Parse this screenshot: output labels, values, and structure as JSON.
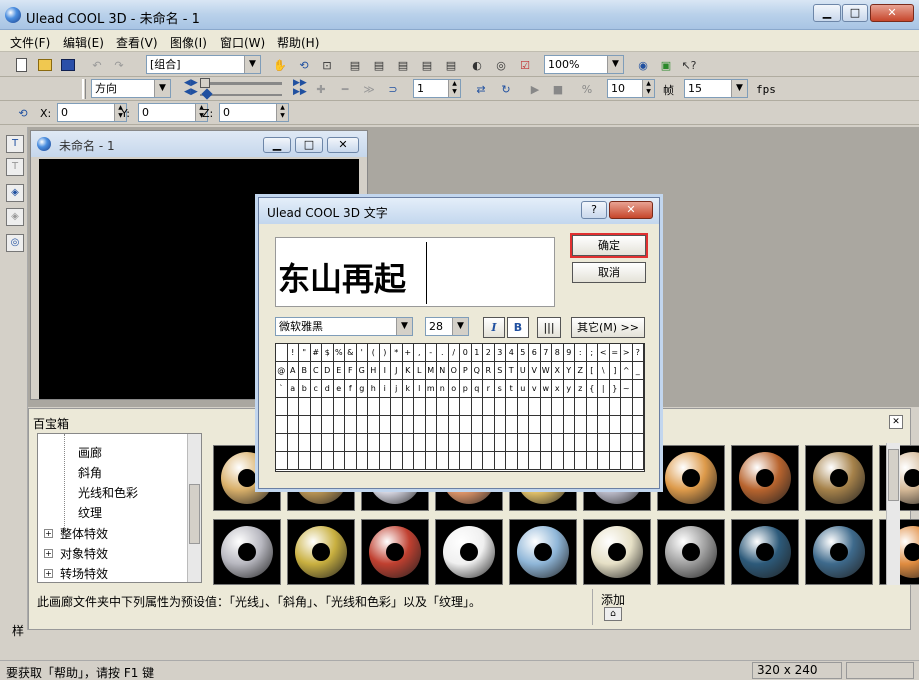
{
  "window": {
    "title": "Ulead COOL 3D - 未命名 - 1",
    "min": "▁",
    "max": "□",
    "close": "✕"
  },
  "menu": [
    "文件(F)",
    "编辑(E)",
    "查看(V)",
    "图像(I)",
    "窗口(W)",
    "帮助(H)"
  ],
  "toolbar1": {
    "group_combo": "[组合]",
    "zoom_combo": "100%"
  },
  "toolbar2": {
    "direction_combo": "方向",
    "frame_value": "1",
    "fps_value_a": "10",
    "frame_label": "帧",
    "fps_value_b": "15",
    "fps_label": "fps"
  },
  "toolbar3": {
    "x_label": "X:",
    "x_value": "0",
    "y_label": "Y:",
    "y_value": "0",
    "z_label": "Z:",
    "z_value": "0"
  },
  "doc_window": {
    "title": "未命名 - 1"
  },
  "panel": {
    "title": "百宝箱",
    "tree": [
      "画廊",
      "斜角",
      "光线和色彩",
      "纹理"
    ],
    "tree_groups": [
      "整体特效",
      "对象特效",
      "转场特效"
    ],
    "description": "此画廊文件夹中下列属性为预设值：「光线」、「斜角」、「光线和色彩」以及「纹理」。",
    "add_label": "添加",
    "style_label": "样"
  },
  "status": {
    "help": "要获取「帮助」，请按 F1 键",
    "size": "320 x 240"
  },
  "dialog": {
    "title": "Ulead COOL 3D 文字",
    "help": "?",
    "close": "✕",
    "preview_text": "东山再起",
    "ok": "确定",
    "cancel": "取消",
    "font_combo": "微软雅黑",
    "size_combo": "28",
    "italic": "I",
    "bold": "B",
    "more": "其它(M) >>",
    "char_rows": [
      [
        "",
        "!",
        "\"",
        "#",
        "$",
        "%",
        "&",
        "'",
        "(",
        ")",
        "*",
        "+",
        ",",
        "-",
        ".",
        "/",
        "0",
        "1",
        "2",
        "3",
        "4",
        "5",
        "6",
        "7",
        "8",
        "9",
        ":",
        ";",
        "<",
        "=",
        ">",
        "?"
      ],
      [
        "@",
        "A",
        "B",
        "C",
        "D",
        "E",
        "F",
        "G",
        "H",
        "I",
        "J",
        "K",
        "L",
        "M",
        "N",
        "O",
        "P",
        "Q",
        "R",
        "S",
        "T",
        "U",
        "V",
        "W",
        "X",
        "Y",
        "Z",
        "[",
        "\\",
        "]",
        "^",
        "_"
      ],
      [
        "`",
        "a",
        "b",
        "c",
        "d",
        "e",
        "f",
        "g",
        "h",
        "i",
        "j",
        "k",
        "l",
        "m",
        "n",
        "o",
        "p",
        "q",
        "r",
        "s",
        "t",
        "u",
        "v",
        "w",
        "x",
        "y",
        "z",
        "{",
        "|",
        "}",
        "~",
        ""
      ]
    ]
  },
  "colors": {
    "ok_highlight": "#e03030"
  },
  "thumb_colors": [
    [
      "#d9b06a",
      "#c8a05a",
      "#e6e6f2",
      "#f0a070",
      "#f3d070",
      "#c9c9d8",
      "#dd9a4a",
      "#b8642e",
      "#a6824a",
      "#d4b896"
    ],
    [
      "#b8b8c0",
      "#c9b040",
      "#c04030",
      "#f0f0f0",
      "#8fb6d8",
      "#e6e0c6",
      "#a0a0a0",
      "#2d5a7a",
      "#3e6a8c",
      "#e08c40"
    ]
  ]
}
